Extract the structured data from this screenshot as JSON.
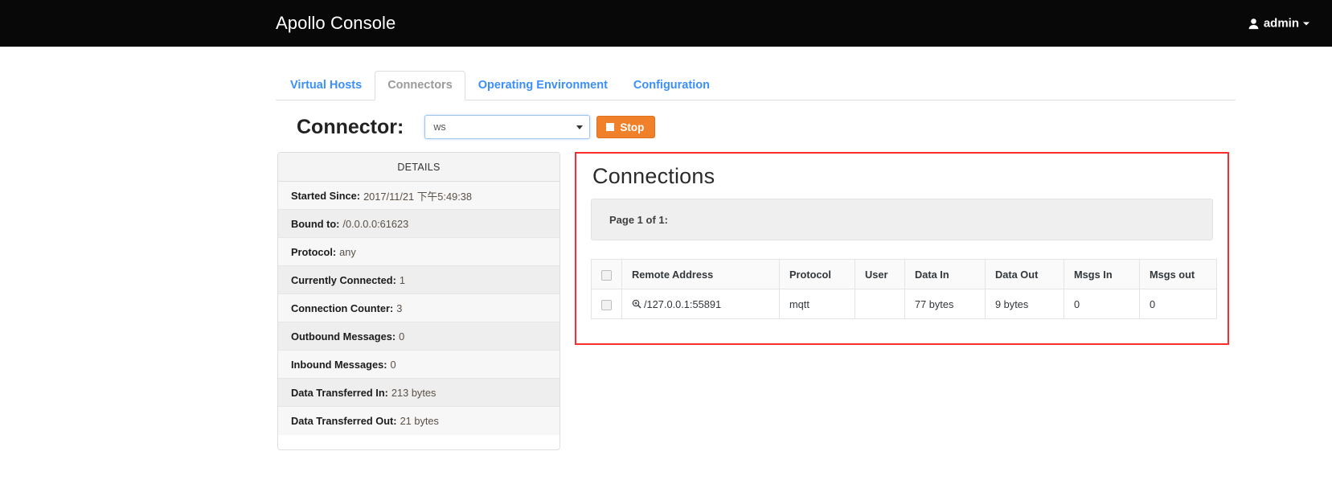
{
  "navbar": {
    "brand": "Apollo Console",
    "user": "admin",
    "user_icon": "user-icon",
    "caret_icon": "caret-down-icon"
  },
  "tabs": [
    {
      "label": "Virtual Hosts",
      "active": false
    },
    {
      "label": "Connectors",
      "active": true
    },
    {
      "label": "Operating Environment",
      "active": false
    },
    {
      "label": "Configuration",
      "active": false
    }
  ],
  "connector_bar": {
    "label": "Connector:",
    "selected": "ws",
    "options": [
      "ws"
    ],
    "stop_label": "Stop",
    "stop_icon": "stop-square-icon",
    "stop_color": "#f0802a"
  },
  "details": {
    "heading": "DETAILS",
    "rows": [
      {
        "label": "Started Since:",
        "value": "2017/11/21 下午5:49:38"
      },
      {
        "label": "Bound to:",
        "value": "/0.0.0.0:61623"
      },
      {
        "label": "Protocol:",
        "value": "any"
      },
      {
        "label": "Currently Connected:",
        "value": "1"
      },
      {
        "label": "Connection Counter:",
        "value": "3"
      },
      {
        "label": "Outbound Messages:",
        "value": "0"
      },
      {
        "label": "Inbound Messages:",
        "value": "0"
      },
      {
        "label": "Data Transferred In:",
        "value": "213 bytes"
      },
      {
        "label": "Data Transferred Out:",
        "value": "21 bytes"
      }
    ]
  },
  "connections": {
    "title": "Connections",
    "page_info": "Page 1 of 1:",
    "highlight_color": "#fb2c2c",
    "columns": [
      "Remote Address",
      "Protocol",
      "User",
      "Data In",
      "Data Out",
      "Msgs In",
      "Msgs out"
    ],
    "rows": [
      {
        "remote_address": "/127.0.0.1:55891",
        "address_icon": "zoom-in-icon",
        "protocol": "mqtt",
        "user": "",
        "data_in": "77 bytes",
        "data_out": "9 bytes",
        "msgs_in": "0",
        "msgs_out": "0"
      }
    ]
  }
}
